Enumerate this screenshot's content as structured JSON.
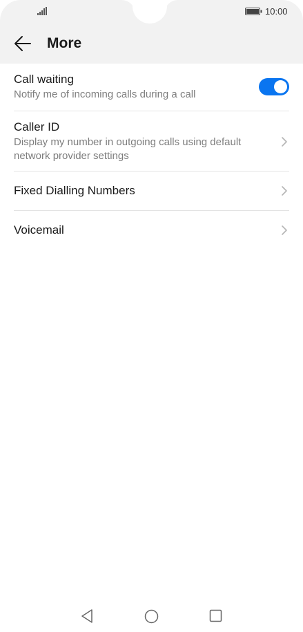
{
  "status": {
    "time": "10:00",
    "signal_icon": "signal-icon",
    "battery_icon": "battery-icon"
  },
  "header": {
    "title": "More",
    "back_icon": "arrow-left-icon"
  },
  "settings": {
    "call_waiting": {
      "label": "Call waiting",
      "description": "Notify me of incoming calls during a call",
      "toggle_on": true,
      "accent": "#0a75f0"
    },
    "caller_id": {
      "label": "Caller ID",
      "description": "Display my number in outgoing calls using default network provider settings"
    },
    "fixed_dialling": {
      "label": "Fixed Dialling Numbers"
    },
    "voicemail": {
      "label": "Voicemail"
    }
  },
  "nav": {
    "back_icon": "triangle-back-icon",
    "home_icon": "circle-home-icon",
    "recents_icon": "square-recents-icon"
  }
}
